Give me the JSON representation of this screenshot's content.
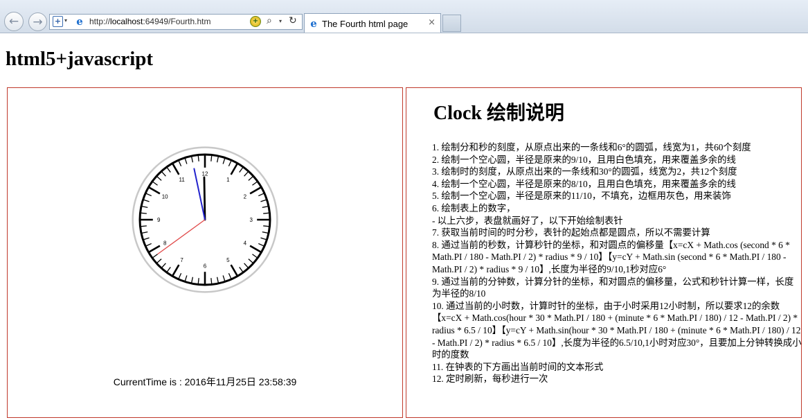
{
  "browser": {
    "back_glyph": "←",
    "forward_glyph": "→",
    "url_prefix": "http://",
    "url_host": "localhost",
    "url_rest": ":64949/Fourth.htm",
    "tab_title": "The Fourth html page",
    "tab_close": "×",
    "icons": [
      "back-icon",
      "forward-icon",
      "compatibility-icon",
      "ie-icon",
      "search-icon",
      "refresh-icon",
      "close-icon"
    ]
  },
  "page": {
    "heading": "html5+javascript"
  },
  "clock": {
    "numbers": [
      "12",
      "1",
      "2",
      "3",
      "4",
      "5",
      "6",
      "7",
      "8",
      "9",
      "10",
      "11"
    ],
    "hour": 23,
    "minute": 58,
    "second": 39,
    "current_time_text": "CurrentTime is : 2016年11月25日 23:58:39",
    "colors": {
      "rim": "#c8c8c8",
      "face": "#ffffff",
      "ticks": "#000000",
      "hour_hand": "#000000",
      "minute_hand": "#2222cc",
      "second_hand": "#e04848"
    }
  },
  "description": {
    "title": "Clock 绘制说明",
    "steps": [
      "1. 绘制分和秒的刻度，从原点出来的一条线和6°的圆弧，线宽为1，共60个刻度",
      "2. 绘制一个空心圆，半径是原来的9/10，且用白色填充，用来覆盖多余的线",
      "3. 绘制时的刻度，从原点出来的一条线和30°的圆弧，线宽为2，共12个刻度",
      "4. 绘制一个空心圆，半径是原来的8/10，且用白色填充，用来覆盖多余的线",
      "5. 绘制一个空心圆，半径是原来的11/10，不填充，边框用灰色，用来装饰",
      "6. 绘制表上的数字，",
      "- 以上六步，表盘就画好了，以下开始绘制表针",
      "7. 获取当前时间的时分秒，表针的起始点都是圆点，所以不需要计算",
      "8. 通过当前的秒数，计算秒针的坐标，和对圆点的偏移量【x=cX + Math.cos (second * 6 * Math.PI / 180 - Math.PI / 2) * radius * 9 / 10】【y=cY + Math.sin (second * 6 * Math.PI / 180 - Math.PI / 2) * radius * 9 / 10】,长度为半径的9/10,1秒对应6°",
      "9. 通过当前的分钟数，计算分针的坐标，和对圆点的偏移量，公式和秒针计算一样，长度为半径的8/10",
      "10. 通过当前的小时数，计算时针的坐标，由于小时采用12小时制，所以要求12的余数【x=cX + Math.cos(hour * 30 * Math.PI / 180 + (minute * 6 * Math.PI / 180) / 12 - Math.PI / 2) * radius * 6.5 / 10】【y=cY + Math.sin(hour * 30 * Math.PI / 180 + (minute * 6 * Math.PI / 180) / 12 - Math.PI / 2) * radius * 6.5 / 10】,长度为半径的6.5/10,1小时对应30°，且要加上分钟转换成小时的度数",
      "11. 在钟表的下方画出当前时间的文本形式",
      "12. 定时刷新，每秒进行一次"
    ]
  }
}
